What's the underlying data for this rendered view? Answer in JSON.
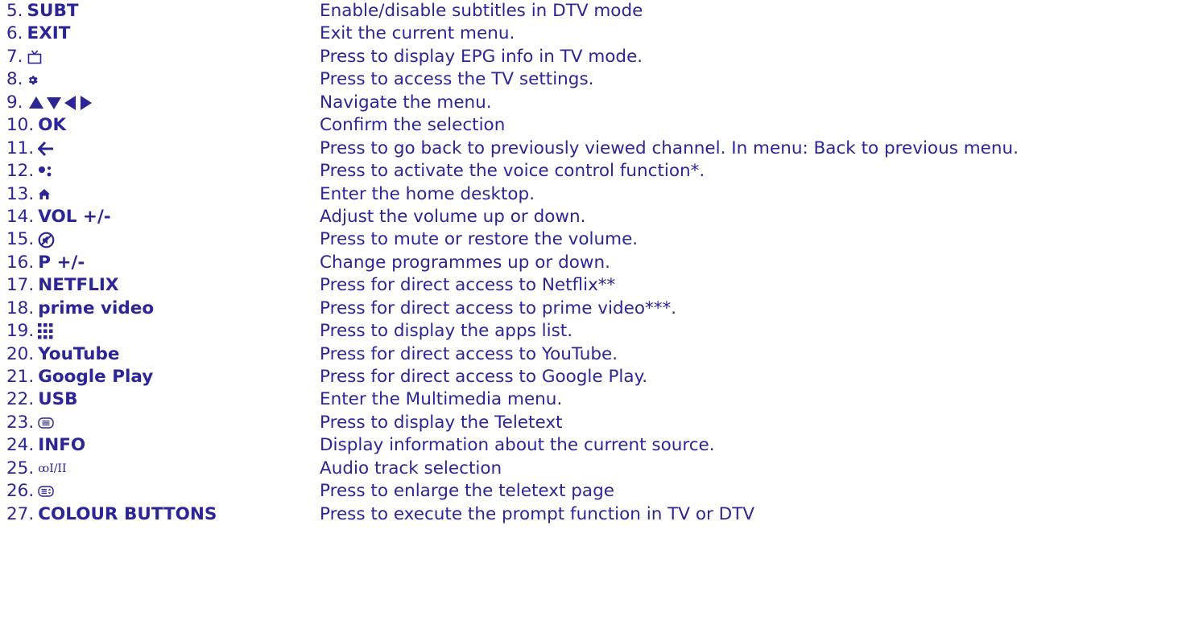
{
  "colors": {
    "text": "#2b2595"
  },
  "rows": [
    {
      "num": "5.",
      "label": "SUBT",
      "icon": "",
      "desc": "Enable/disable subtitles in DTV mode"
    },
    {
      "num": "6.",
      "label": "EXIT",
      "icon": "",
      "desc": "Exit the current menu."
    },
    {
      "num": "7.",
      "label": "",
      "icon": "tv-icon",
      "desc": "Press to display EPG info in TV mode."
    },
    {
      "num": "8.",
      "label": "",
      "icon": "gear-icon",
      "desc": "Press to access the TV settings."
    },
    {
      "num": "9.",
      "label": "",
      "icon": "navigation-arrows-icon",
      "desc": "Navigate the menu."
    },
    {
      "num": "10.",
      "label": "OK",
      "icon": "",
      "desc": "Confirm the selection"
    },
    {
      "num": "11.",
      "label": "",
      "icon": "back-arrow-icon",
      "desc": "Press to go back to previously viewed channel. In menu: Back to previous menu."
    },
    {
      "num": "12.",
      "label": "",
      "icon": "voice-assistant-icon",
      "desc": "Press to activate the voice control function*."
    },
    {
      "num": "13.",
      "label": "",
      "icon": "home-icon",
      "desc": "Enter the home desktop."
    },
    {
      "num": "14.",
      "label": "VOL +/-",
      "icon": "",
      "desc": "Adjust the volume up or down."
    },
    {
      "num": "15.",
      "label": "",
      "icon": "mute-icon",
      "desc": "Press to mute or restore the volume."
    },
    {
      "num": "16.",
      "label": "P +/-",
      "icon": "",
      "desc": "Change programmes up or down."
    },
    {
      "num": "17.",
      "label": "NETFLIX",
      "icon": "",
      "desc": "Press for direct access to Netflix**"
    },
    {
      "num": "18.",
      "label": "prime video",
      "icon": "",
      "desc": "Press for direct access to prime video***."
    },
    {
      "num": "19.",
      "label": "",
      "icon": "apps-grid-icon",
      "desc": "Press to display the apps list."
    },
    {
      "num": "20.",
      "label": "YouTube",
      "icon": "",
      "desc": "Press for direct access to YouTube."
    },
    {
      "num": "21.",
      "label": "Google Play",
      "icon": "",
      "desc": "Press for direct access to Google Play."
    },
    {
      "num": "22.",
      "label": "USB",
      "icon": "",
      "desc": "Enter the Multimedia menu."
    },
    {
      "num": "23.",
      "label": "",
      "icon": "teletext-icon",
      "desc": "Press to display the Teletext"
    },
    {
      "num": "24.",
      "label": "INFO",
      "icon": "",
      "desc": "Display information about the current source."
    },
    {
      "num": "25.",
      "label": "",
      "icon": "audio-track-icon",
      "desc": "Audio track selection"
    },
    {
      "num": "26.",
      "label": "",
      "icon": "teletext-enlarge-icon",
      "desc": "Press to enlarge the teletext page"
    },
    {
      "num": "27.",
      "label": "COLOUR BUTTONS",
      "icon": "",
      "desc": "Press to execute the prompt function in TV or DTV"
    }
  ],
  "icon_glyphs": {
    "audio_track": "ꝏI/II"
  }
}
